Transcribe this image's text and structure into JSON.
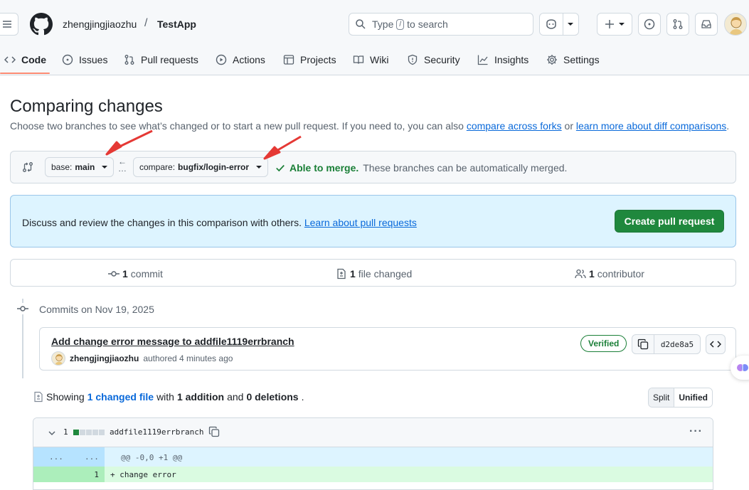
{
  "header": {
    "owner": "zhengjingjiaozhu",
    "separator": "/",
    "repo": "TestApp",
    "search_prefix": "Type",
    "search_key": "/",
    "search_suffix": "to search"
  },
  "tabs": [
    {
      "label": "Code",
      "icon": "code-icon",
      "active": true
    },
    {
      "label": "Issues",
      "icon": "issue-icon"
    },
    {
      "label": "Pull requests",
      "icon": "pull-request-icon"
    },
    {
      "label": "Actions",
      "icon": "play-icon"
    },
    {
      "label": "Projects",
      "icon": "table-icon"
    },
    {
      "label": "Wiki",
      "icon": "book-icon"
    },
    {
      "label": "Security",
      "icon": "shield-icon"
    },
    {
      "label": "Insights",
      "icon": "graph-icon"
    },
    {
      "label": "Settings",
      "icon": "gear-icon"
    }
  ],
  "page": {
    "title": "Comparing changes",
    "subtitle_pre": "Choose two branches to see what’s changed or to start a new pull request. If you need to, you can also",
    "link_forks": "compare across forks",
    "subtitle_mid": "or",
    "link_learn": "learn more about diff comparisons",
    "subtitle_end": "."
  },
  "range": {
    "base_prefix": "base:",
    "base_branch": "main",
    "compare_prefix": "compare:",
    "compare_branch": "bugfix/login-error",
    "merge_status": "Able to merge.",
    "merge_detail": "These branches can be automatically merged."
  },
  "discuss": {
    "message": "Discuss and review the changes in this comparison with others.",
    "link": "Learn about pull requests",
    "button": "Create pull request"
  },
  "stats": {
    "commits_count": "1",
    "commits_label": "commit",
    "files_count": "1",
    "files_label": "file changed",
    "contrib_count": "1",
    "contrib_label": "contributor"
  },
  "commits": {
    "date_label": "Commits on Nov 19, 2025",
    "items": [
      {
        "title": "Add change error message to addfile1119errbranch",
        "author": "zhengjingjiaozhu",
        "action": "authored 4 minutes ago",
        "badge": "Verified",
        "sha": "d2de8a5"
      }
    ]
  },
  "diff_summary": {
    "showing": "Showing",
    "changed_files": "1 changed file",
    "with": "with",
    "additions": "1 addition",
    "and": "and",
    "deletions": "0 deletions",
    "end": ".",
    "view_split": "Split",
    "view_unified": "Unified"
  },
  "diff": {
    "change_count": "1",
    "filename": "addfile1119errbranch",
    "diffstat": [
      "added",
      "neutral",
      "neutral",
      "neutral",
      "neutral"
    ],
    "hunk_left": "...",
    "hunk_right": "...",
    "hunk_header": "@@ -0,0 +1 @@",
    "lines": [
      {
        "new_no": "1",
        "text": "+ change error"
      }
    ]
  },
  "colors": {
    "accent_green": "#1f883d",
    "annotation_red": "#e53935",
    "link_blue": "#0969da"
  }
}
